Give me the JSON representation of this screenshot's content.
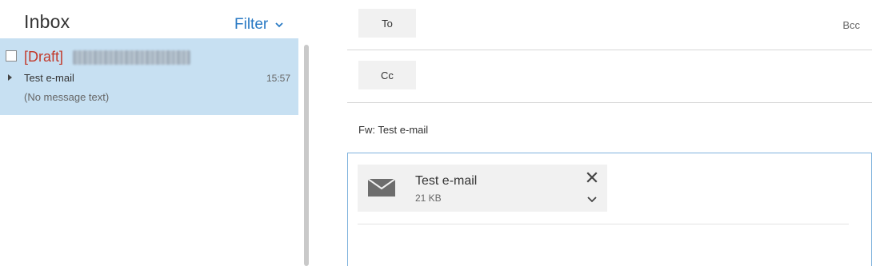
{
  "list": {
    "title": "Inbox",
    "filter_label": "Filter",
    "item": {
      "draft_tag": "[Draft]",
      "subject": "Test e-mail",
      "time": "15:57",
      "preview": "(No message text)"
    }
  },
  "compose": {
    "to_label": "To",
    "cc_label": "Cc",
    "bcc_label": "Bcc",
    "subject": "Fw: Test e-mail",
    "attachment": {
      "name": "Test e-mail",
      "size": "21 KB",
      "icon": "envelope-icon"
    }
  },
  "colors": {
    "accent": "#2a7ac4",
    "selected_row": "#c7e0f2",
    "draft_red": "#c23a2c",
    "focus_border": "#7fb2dd"
  }
}
